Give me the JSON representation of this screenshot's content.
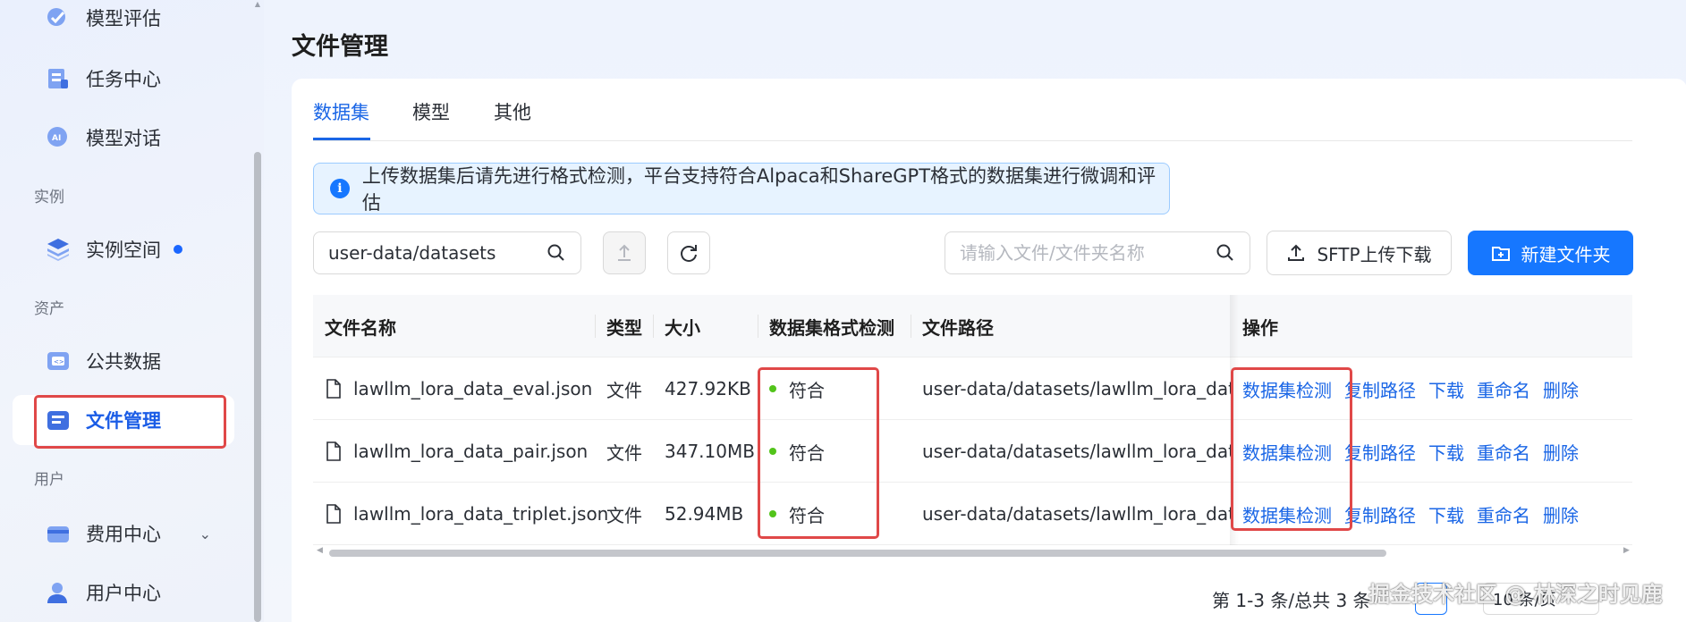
{
  "sidebar": {
    "items": [
      {
        "label": "模型评估",
        "icon": "model-eval-icon"
      },
      {
        "label": "任务中心",
        "icon": "task-center-icon"
      },
      {
        "label": "模型对话",
        "icon": "ai-chat-icon"
      },
      {
        "label": "实例空间",
        "icon": "layers-icon"
      },
      {
        "label": "公共数据",
        "icon": "public-data-icon"
      },
      {
        "label": "文件管理",
        "icon": "file-manage-icon"
      },
      {
        "label": "费用中心",
        "icon": "billing-icon"
      },
      {
        "label": "用户中心",
        "icon": "user-icon"
      }
    ],
    "groups": [
      "实例",
      "资产",
      "用户"
    ],
    "active_item": "文件管理"
  },
  "page": {
    "title": "文件管理"
  },
  "tabs": [
    {
      "label": "数据集"
    },
    {
      "label": "模型"
    },
    {
      "label": "其他"
    }
  ],
  "alert": {
    "text": "上传数据集后请先进行格式检测，平台支持符合Alpaca和ShareGPT格式的数据集进行微调和评估"
  },
  "toolbar": {
    "path_value": "user-data/datasets",
    "search_placeholder": "请输入文件/文件夹名称",
    "sftp_label": "SFTP上传下载",
    "new_folder_label": "新建文件夹"
  },
  "table": {
    "headers": [
      "文件名称",
      "类型",
      "大小",
      "数据集格式检测",
      "文件路径",
      "操作"
    ],
    "rows": [
      {
        "name": "lawllm_lora_data_eval.json",
        "type": "文件",
        "size": "427.92KB",
        "check": "符合",
        "path": "user-data/datasets/lawllm_lora_data_eval.json"
      },
      {
        "name": "lawllm_lora_data_pair.json",
        "type": "文件",
        "size": "347.10MB",
        "check": "符合",
        "path": "user-data/datasets/lawllm_lora_data_pair.json"
      },
      {
        "name": "lawllm_lora_data_triplet.json",
        "type": "文件",
        "size": "52.94MB",
        "check": "符合",
        "path": "user-data/datasets/lawllm_lora_data_triplet.json"
      }
    ],
    "actions": [
      "数据集检测",
      "复制路径",
      "下载",
      "重命名",
      "删除"
    ]
  },
  "pagination": {
    "total_text": "第 1-3 条/总共 3 条",
    "page_size": "10 条/页"
  },
  "watermark": "掘金技术社区 @ 林深之时见鹿",
  "colors": {
    "primary": "#1677ff",
    "highlight": "#e04848",
    "success": "#52c41a"
  }
}
